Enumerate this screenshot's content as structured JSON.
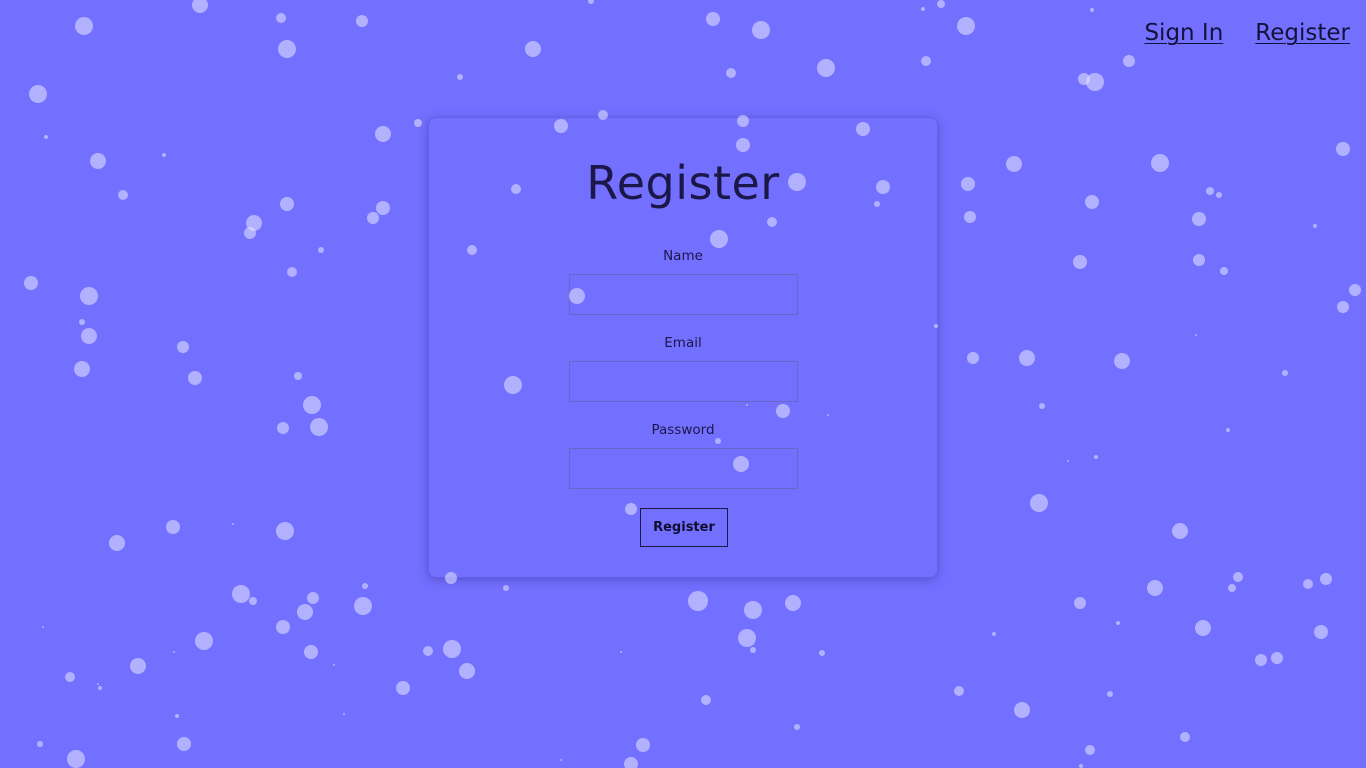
{
  "nav": {
    "sign_in_label": "Sign In",
    "register_label": "Register"
  },
  "form": {
    "title": "Register",
    "name_label": "Name",
    "name_value": "",
    "email_label": "Email",
    "email_value": "",
    "password_label": "Password",
    "password_value": "",
    "submit_label": "Register"
  },
  "colors": {
    "background": "#7470ff",
    "text": "#1b1748",
    "snowflake": "#e6e8ff"
  }
}
